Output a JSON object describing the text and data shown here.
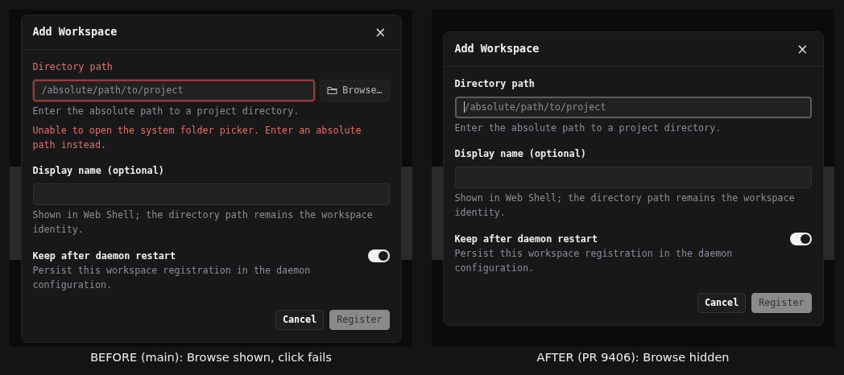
{
  "panels": [
    {
      "caption": "BEFORE (main): Browse shown, click fails",
      "dialog": {
        "title": "Add Workspace",
        "close": "×",
        "path_field": {
          "label": "Directory path",
          "placeholder": "/absolute/path/to/project",
          "invalid": true,
          "focused": false,
          "hint": "Enter the absolute path to a project directory.",
          "error": "Unable to open the system folder picker. Enter an absolute path instead.",
          "browse_button": "Browse…"
        },
        "name_field": {
          "label": "Display name (optional)",
          "hint": "Shown in Web Shell; the directory path remains the workspace identity."
        },
        "keep_toggle": {
          "label": "Keep after daemon restart",
          "description": "Persist this workspace registration in the daemon configuration.",
          "on": true
        },
        "buttons": [
          {
            "label": "Cancel",
            "kind": "secondary",
            "disabled": false
          },
          {
            "label": "Register",
            "kind": "primary",
            "disabled": true
          }
        ]
      }
    },
    {
      "caption": "AFTER (PR 9406): Browse hidden",
      "dialog": {
        "title": "Add Workspace",
        "close": "×",
        "path_field": {
          "label": "Directory path",
          "placeholder": "/absolute/path/to/project",
          "invalid": false,
          "focused": true,
          "hint": "Enter the absolute path to a project directory."
        },
        "name_field": {
          "label": "Display name (optional)",
          "hint": "Shown in Web Shell; the directory path remains the workspace identity."
        },
        "keep_toggle": {
          "label": "Keep after daemon restart",
          "description": "Persist this workspace registration in the daemon configuration.",
          "on": true
        },
        "buttons": [
          {
            "label": "Cancel",
            "kind": "secondary",
            "disabled": false
          },
          {
            "label": "Register",
            "kind": "primary",
            "disabled": true
          }
        ]
      }
    }
  ]
}
